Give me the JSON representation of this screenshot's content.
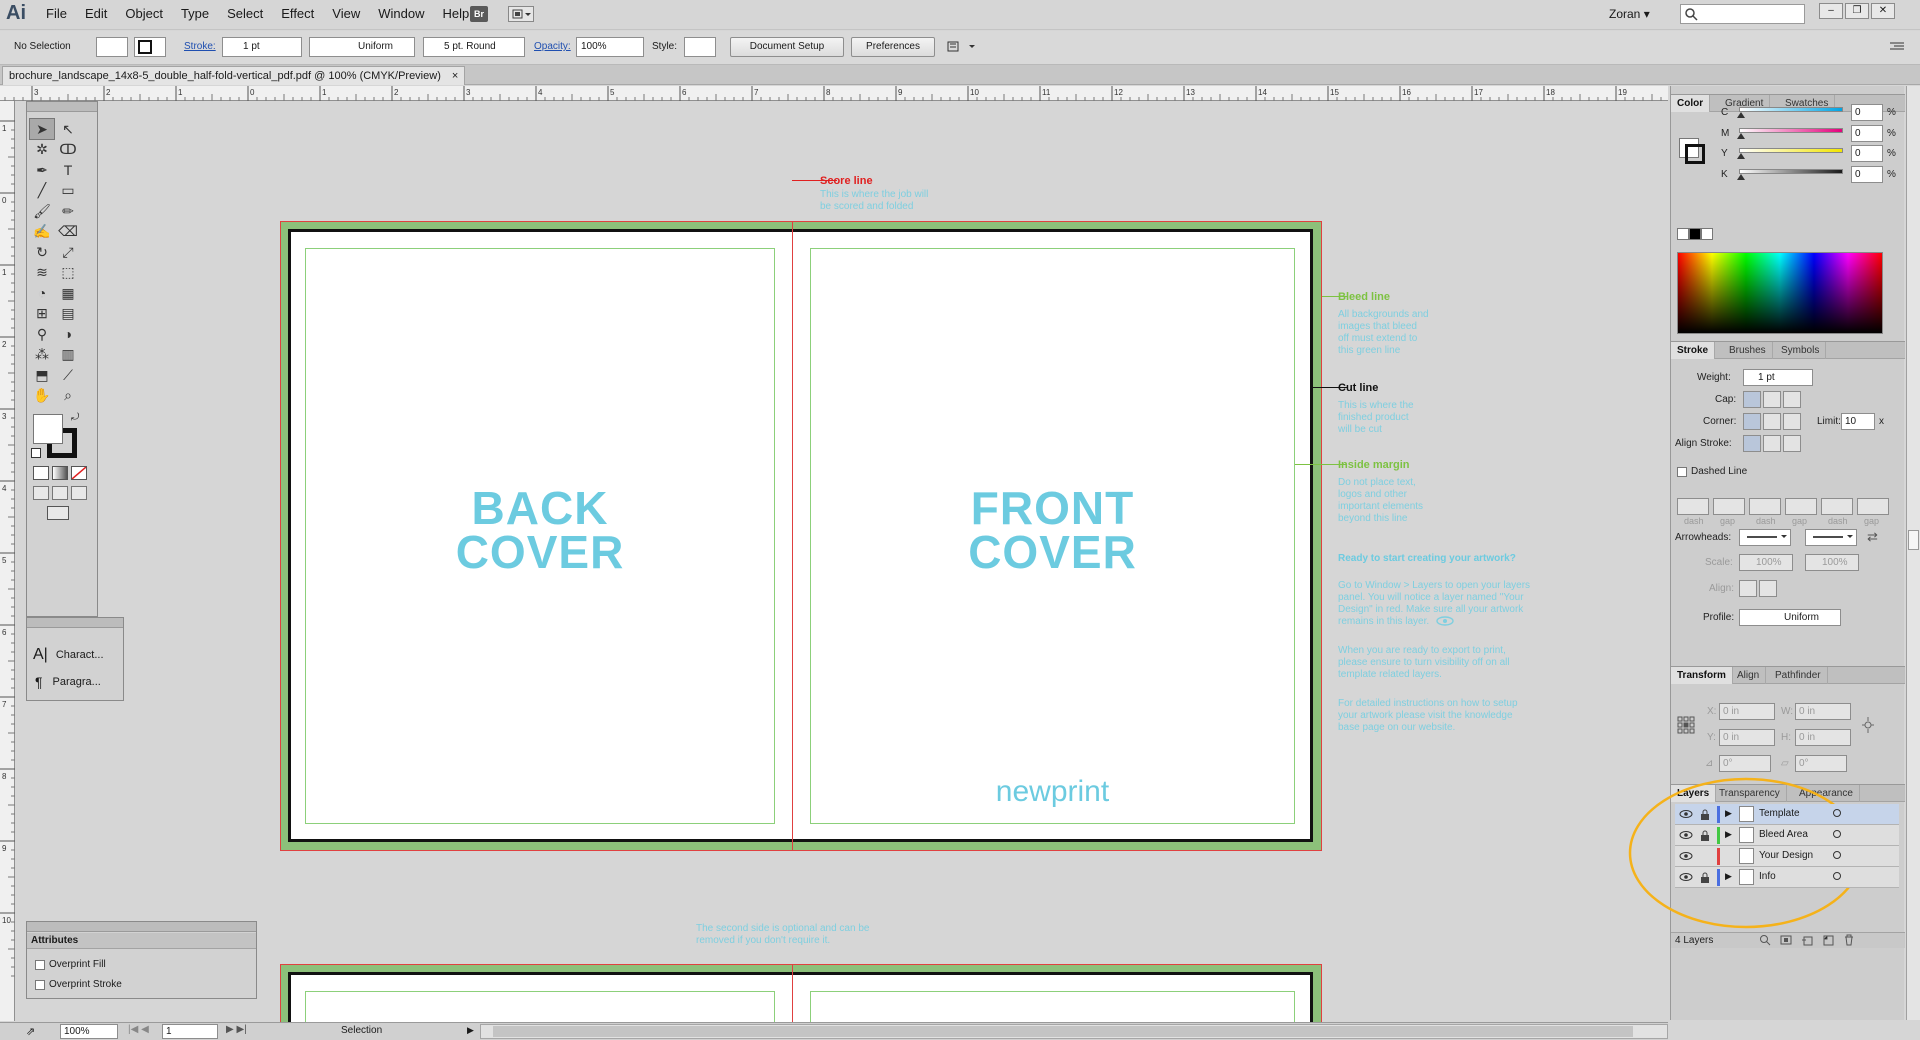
{
  "app": {
    "logo": "Ai",
    "bridge": "Br",
    "user": "Zoran",
    "search_placeholder": ""
  },
  "menus": [
    "File",
    "Edit",
    "Object",
    "Type",
    "Select",
    "Effect",
    "View",
    "Window",
    "Help"
  ],
  "window_controls": [
    "–",
    "❐",
    "✕"
  ],
  "control_bar": {
    "selection": "No Selection",
    "stroke_label": "Stroke:",
    "stroke_weight": "1 pt",
    "profile": "Uniform",
    "brush": "5 pt. Round",
    "opacity_label": "Opacity:",
    "opacity": "100%",
    "style_label": "Style:",
    "document_setup": "Document Setup",
    "preferences": "Preferences"
  },
  "document_tab": {
    "title": "brochure_landscape_14x8-5_double_half-fold-vertical_pdf.pdf @ 100% (CMYK/Preview)",
    "close": "×"
  },
  "rulers": {
    "h_ticks": [
      "4",
      "3",
      "2",
      "1",
      "0",
      "1",
      "2",
      "3",
      "4",
      "5",
      "6",
      "7",
      "8",
      "9",
      "10",
      "11",
      "12",
      "13",
      "14",
      "15",
      "16",
      "17",
      "18",
      "19",
      "20",
      "21"
    ],
    "v_ticks": [
      "1",
      "0",
      "1",
      "2",
      "3",
      "4",
      "5",
      "6",
      "7",
      "8",
      "9",
      "10"
    ]
  },
  "artboard": {
    "back_cover": [
      "BACK",
      "COVER"
    ],
    "front_cover": [
      "FRONT",
      "COVER"
    ],
    "logo_text": "newprint",
    "second_side_note": [
      "The second side is optional and can be",
      "removed if you don't require it."
    ]
  },
  "annotations": {
    "score": {
      "title": "Score line",
      "body": [
        "This is where the job will",
        "be scored and folded"
      ],
      "color": "#e02020"
    },
    "bleed": {
      "title": "Bleed line",
      "body": [
        "All backgrounds and",
        "images that bleed",
        "off must extend to",
        "this green line"
      ],
      "color": "#7dc242"
    },
    "cut": {
      "title": "Cut line",
      "body": [
        "This is where the",
        "finished product",
        "will be cut"
      ],
      "color": "#111111"
    },
    "margin": {
      "title": "Inside margin",
      "body": [
        "Do not place text,",
        "logos and other",
        "important elements",
        "beyond this line"
      ],
      "color": "#7dc242"
    },
    "start": {
      "title": "Ready to start creating your artwork?",
      "p1": [
        "Go to Window > Layers to open your layers",
        "panel. You will notice a layer named \"Your",
        "Design\" in red. Make sure all your artwork",
        "remains in this layer."
      ],
      "p2": [
        "When you are ready to export to print,",
        "please ensure to turn visibility off on all",
        "template related layers."
      ],
      "p3": [
        "For detailed instructions on how to setup",
        "your artwork please visit the knowledge",
        "base page on our website."
      ]
    }
  },
  "type_panel": {
    "items": [
      "Charact...",
      "Paragra..."
    ]
  },
  "attributes_panel": {
    "title": "Attributes",
    "options": [
      "Overprint Fill",
      "Overprint Stroke"
    ]
  },
  "color_panel": {
    "tabs": [
      "Color",
      "Gradient",
      "Swatches"
    ],
    "channels": [
      {
        "label": "C",
        "value": "0",
        "color": "#00a4e4"
      },
      {
        "label": "M",
        "value": "0",
        "color": "#e4007c"
      },
      {
        "label": "Y",
        "value": "0",
        "color": "#f2e500"
      },
      {
        "label": "K",
        "value": "0",
        "color": "#1a1a1a"
      }
    ],
    "unit": "%"
  },
  "stroke_panel": {
    "tabs": [
      "Stroke",
      "Brushes",
      "Symbols"
    ],
    "weight_label": "Weight:",
    "weight": "1 pt",
    "cap_label": "Cap:",
    "corner_label": "Corner:",
    "limit_label": "Limit:",
    "limit": "10",
    "limit_unit": "x",
    "align_label": "Align Stroke:",
    "dashed_label": "Dashed Line",
    "dash_labels": [
      "dash",
      "gap",
      "dash",
      "gap",
      "dash",
      "gap"
    ],
    "arrowheads_label": "Arrowheads:",
    "scale_label": "Scale:",
    "scale_a": "100%",
    "scale_b": "100%",
    "align2_label": "Align:",
    "profile_label": "Profile:",
    "profile": "Uniform"
  },
  "transform_panel": {
    "tabs": [
      "Transform",
      "Align",
      "Pathfinder"
    ],
    "x_label": "X:",
    "x": "0 in",
    "w_label": "W:",
    "w": "0 in",
    "y_label": "Y:",
    "y": "0 in",
    "h_label": "H:",
    "h": "0 in",
    "angle": "0°",
    "shear": "0°"
  },
  "layers_panel": {
    "tabs": [
      "Layers",
      "Transparency",
      "Appearance"
    ],
    "layers": [
      {
        "name": "Template",
        "locked": true,
        "expandable": true,
        "color": "#4b6fe0",
        "selected": true
      },
      {
        "name": "Bleed Area",
        "locked": true,
        "expandable": true,
        "color": "#43c843",
        "selected": false
      },
      {
        "name": "Your Design",
        "locked": false,
        "expandable": false,
        "color": "#e04040",
        "selected": false
      },
      {
        "name": "Info",
        "locked": true,
        "expandable": true,
        "color": "#4b6fe0",
        "selected": false
      }
    ],
    "count": "4 Layers"
  },
  "status_bar": {
    "zoom": "100%",
    "page": "1",
    "tool": "Selection"
  },
  "colors": {
    "accent_cyan": "#6ccbe0",
    "bleed_green": "#8cc07a",
    "cut_black": "#111111",
    "score_red": "#e02020",
    "highlight": "#f5b21a"
  }
}
